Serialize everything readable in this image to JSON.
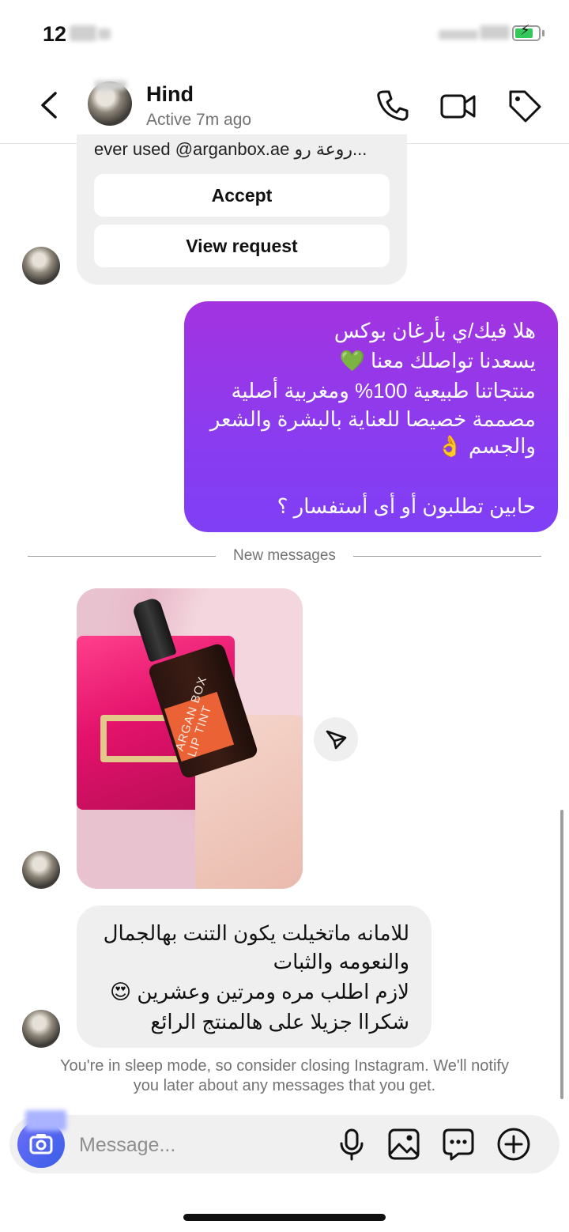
{
  "status_bar": {
    "time": "12"
  },
  "header": {
    "contact_name": "Hind",
    "contact_status": "Active 7m ago"
  },
  "incoming_request": {
    "preview_text": "ever used @arganbox.ae  روعة رو...",
    "accept_label": "Accept",
    "view_request_label": "View request"
  },
  "outgoing_message": {
    "lines": [
      "هلا فيك/ي بأرغان بوكس",
      "يسعدنا تواصلك معنا 💚",
      "منتجاتنا طبيعية 100% ومغربية أصلية",
      "مصممة خصيصا للعناية بالبشرة والشعر",
      "والجسم 👌",
      "حابين تطلبون أو أى أستفسار ؟"
    ]
  },
  "divider": {
    "label": "New messages"
  },
  "photo_message": {
    "product_text_1": "ARGAN BOX",
    "product_text_2": "LIP TINT"
  },
  "incoming_reply": {
    "lines": [
      "للامانه ماتخيلت يكون التنت بهالجمال",
      "والنعومه والثبات",
      "لازم اطلب مره ومرتين وعشرين 😍",
      "شكراا جزيلا على هالمنتج الرائع"
    ]
  },
  "sleep_notice": {
    "line1": "You're in sleep mode, so consider closing Instagram. We'll notify",
    "line2": "you later about any messages that you get."
  },
  "composer": {
    "placeholder": "Message..."
  },
  "icons": {
    "back": "chevron-left-icon",
    "call": "phone-icon",
    "video": "video-camera-icon",
    "tag": "tag-icon",
    "share": "send-icon",
    "camera": "camera-icon",
    "mic": "microphone-icon",
    "gallery": "image-icon",
    "sticker": "chat-bubble-icon",
    "add": "plus-circle-icon"
  },
  "colors": {
    "outgoing_bubble_top": "#a333e0",
    "outgoing_bubble_bottom": "#7f3ff5",
    "incoming_bubble": "#efefef",
    "camera_button": "#4f5bd5",
    "battery_fill": "#34c759"
  }
}
